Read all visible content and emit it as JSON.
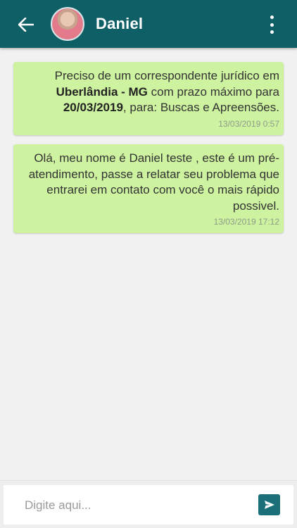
{
  "header": {
    "title": "Daniel",
    "back_icon": "arrow-left-icon",
    "menu_icon": "more-vertical-icon",
    "color": "#0f5f66"
  },
  "messages": [
    {
      "parts": [
        {
          "text": "Preciso de um correspondente jurídico em ",
          "bold": false
        },
        {
          "text": "Uberlândia - MG",
          "bold": true
        },
        {
          "text": " com prazo máximo para ",
          "bold": false
        },
        {
          "text": "20/03/2019",
          "bold": true
        },
        {
          "text": ", para: Buscas e Apreensões.",
          "bold": false
        }
      ],
      "time": "13/03/2019 0:57"
    },
    {
      "parts": [
        {
          "text": "Olá, meu nome é Daniel teste , este é um pré-atendimento, passe a relatar seu problema que entrarei em contato com você o mais rápido possivel.",
          "bold": false
        }
      ],
      "time": "13/03/2019 17:12"
    }
  ],
  "composer": {
    "placeholder": "Digite aqui...",
    "value": "",
    "send_icon": "send-icon"
  },
  "colors": {
    "bubble": "#cdf2a0",
    "send_button": "#1a6f78"
  }
}
